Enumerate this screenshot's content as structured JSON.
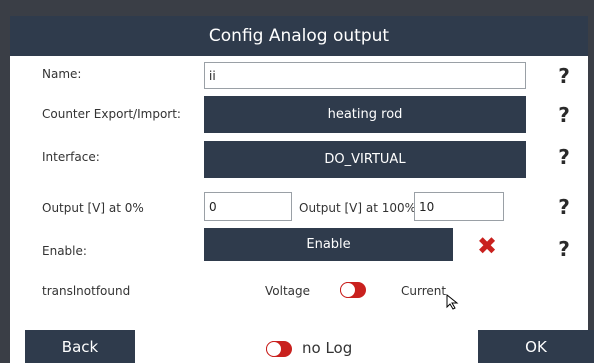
{
  "dialog": {
    "title": "Config Analog output"
  },
  "fields": {
    "name_label": "Name:",
    "name_value": "ii",
    "counter_label": "Counter Export/Import:",
    "counter_value": "heating rod",
    "interface_label": "Interface:",
    "interface_value": "DO_VIRTUAL",
    "output0_label": "Output [V] at 0%",
    "output0_value": "0",
    "output100_label": "Output [V] at 100%",
    "output100_value": "10",
    "enable_label": "Enable:",
    "enable_button": "Enable",
    "mode_label": "translnotfound",
    "mode_left": "Voltage",
    "mode_right": "Current"
  },
  "help": {
    "symbol": "?"
  },
  "enable_status": {
    "icon": "x-mark-icon",
    "symbol": "✖",
    "color": "#c9211e"
  },
  "footer": {
    "back": "Back",
    "log": "no Log",
    "ok": "OK"
  },
  "colors": {
    "header": "#2f3b4c",
    "background": "#3a3e46",
    "toggle": "#c9211e"
  }
}
